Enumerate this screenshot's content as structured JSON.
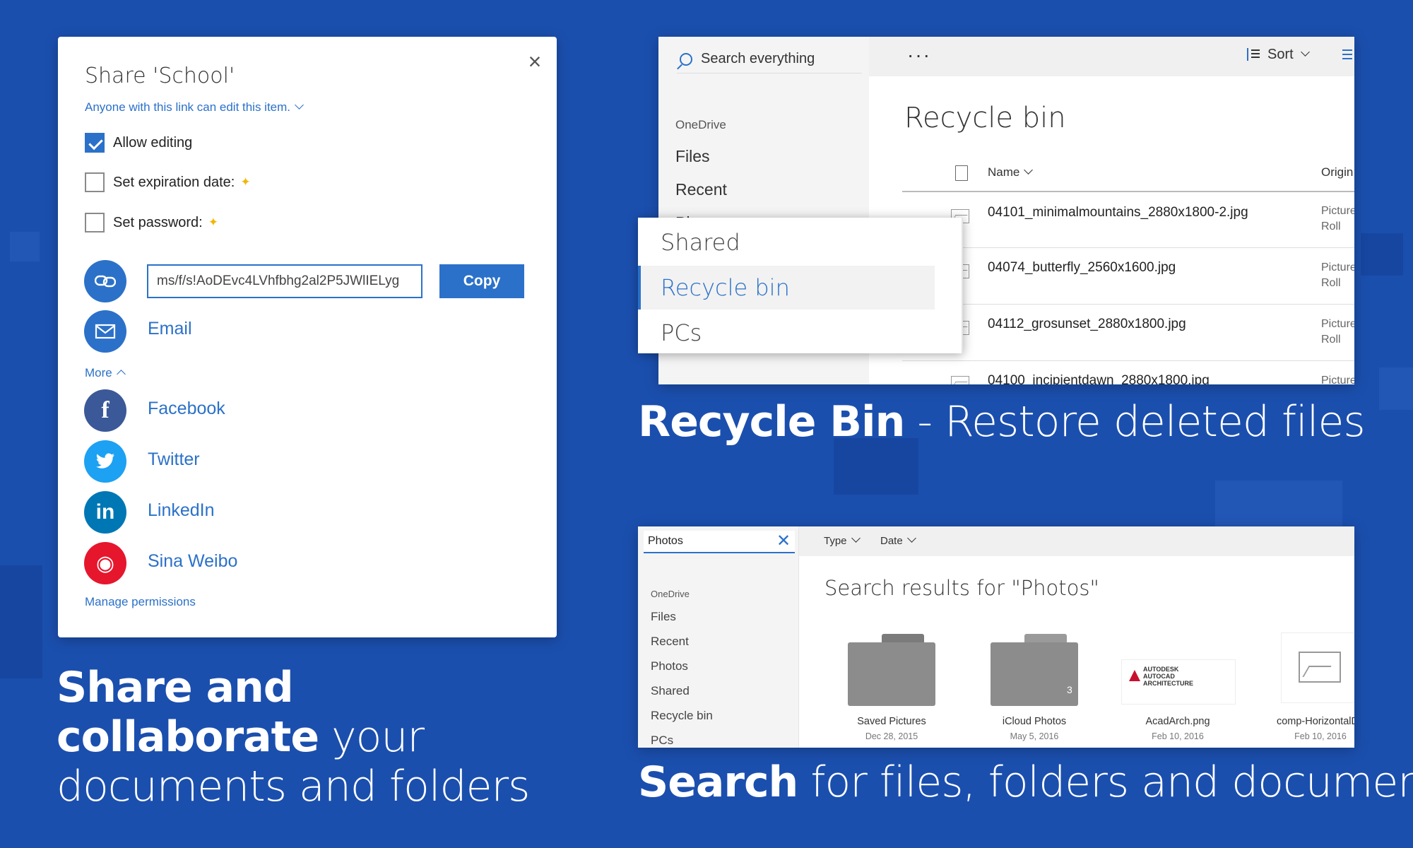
{
  "share": {
    "title": "Share 'School'",
    "link_permission": "Anyone with this link can edit this item.",
    "options": [
      {
        "label": "Allow editing",
        "checked": true,
        "premium": false
      },
      {
        "label": "Set expiration date:",
        "checked": false,
        "premium": true
      },
      {
        "label": "Set password:",
        "checked": false,
        "premium": true
      }
    ],
    "premium_star": "✦",
    "link_value": "ms/f/s!AoDEvc4LVhfbhg2al2P5JWlIELyg",
    "copy_label": "Copy",
    "email_label": "Email",
    "more_label": "More",
    "social": [
      {
        "label": "Facebook",
        "icon": "facebook-icon",
        "color": "#3b5998",
        "glyph": "f"
      },
      {
        "label": "Twitter",
        "icon": "twitter-icon",
        "color": "#1da1f2",
        "glyph": "🐦"
      },
      {
        "label": "LinkedIn",
        "icon": "linkedin-icon",
        "color": "#0077b5",
        "glyph": "in"
      },
      {
        "label": "Sina Weibo",
        "icon": "weibo-icon",
        "color": "#e6162d",
        "glyph": "◉"
      }
    ],
    "manage_label": "Manage permissions",
    "colors": {
      "accent": "#2b71c9",
      "email_circle": "#2b71c9",
      "link_circle": "#2b71c9"
    }
  },
  "captions": {
    "share_bold": "Share and collaborate",
    "share_rest": " your documents and folders",
    "recycle_bold": "Recycle Bin",
    "recycle_rest": " - Restore deleted files",
    "search_bold": "Search",
    "search_rest": " for files, folders and documents"
  },
  "recycle": {
    "search_placeholder": "Search everything",
    "more_dots": "···",
    "sort_label": "Sort",
    "nav_head": "OneDrive",
    "nav": [
      "Files",
      "Recent",
      "Ph"
    ],
    "heading": "Recycle bin",
    "col_name": "Name",
    "col_origin": "Origin",
    "files": [
      {
        "name": "04101_minimalmountains_2880x1800-2.jpg",
        "origin": "Picture Roll"
      },
      {
        "name": "04074_butterfly_2560x1600.jpg",
        "origin": "Picture Roll"
      },
      {
        "name": "04112_grosunset_2880x1800.jpg",
        "origin": "Picture Roll"
      },
      {
        "name": "04100_incipientdawn_2880x1800.jpg",
        "origin": "Picture"
      }
    ],
    "popup": [
      "Shared",
      "Recycle bin",
      "PCs"
    ]
  },
  "search": {
    "query": "Photos",
    "filters": [
      "Type",
      "Date"
    ],
    "nav_head": "OneDrive",
    "nav": [
      "Files",
      "Recent",
      "Photos",
      "Shared",
      "Recycle bin",
      "PCs"
    ],
    "heading": "Search results for \"Photos\"",
    "results": [
      {
        "name": "Saved Pictures",
        "date": "Dec 28, 2015"
      },
      {
        "name": "iCloud Photos",
        "date": "May 5, 2016",
        "count": "3"
      },
      {
        "name": "AcadArch.png",
        "date": "Feb 10, 2016"
      },
      {
        "name": "comp-HorizontalDo",
        "date": "Feb 10, 2016"
      }
    ],
    "acad_text": "AUTODESK AUTOCAD ARCHITECTURE"
  }
}
